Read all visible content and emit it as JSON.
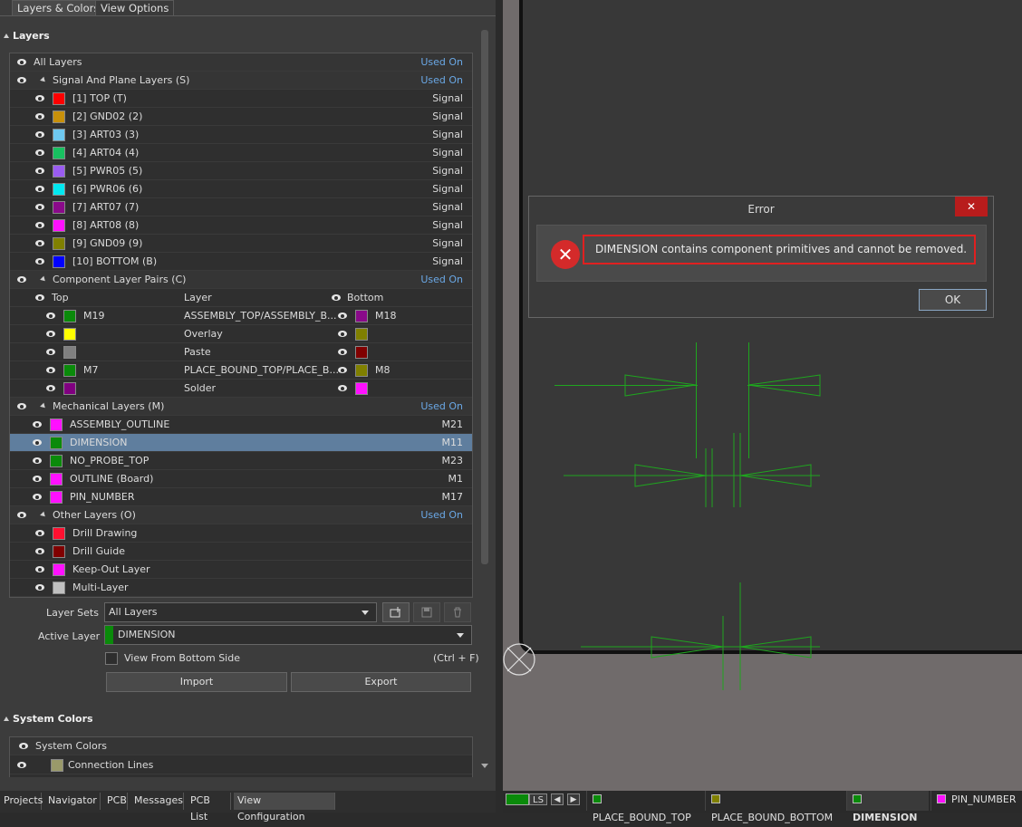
{
  "tabs": {
    "t1": "Layers & Colors",
    "t2": "View Options"
  },
  "layers_title": "Layers",
  "all_layers": {
    "label": "All Layers",
    "used": "Used On"
  },
  "signal": {
    "title": "Signal And Plane Layers (S)",
    "used": "Used On",
    "items": [
      {
        "name": "[1] TOP (T)",
        "type": "Signal",
        "color": "#ff0000"
      },
      {
        "name": "[2] GND02 (2)",
        "type": "Signal",
        "color": "#c8900a"
      },
      {
        "name": "[3] ART03 (3)",
        "type": "Signal",
        "color": "#6ec8f0"
      },
      {
        "name": "[4] ART04 (4)",
        "type": "Signal",
        "color": "#18c060"
      },
      {
        "name": "[5] PWR05 (5)",
        "type": "Signal",
        "color": "#9a5cf0"
      },
      {
        "name": "[6] PWR06 (6)",
        "type": "Signal",
        "color": "#00e8f0"
      },
      {
        "name": "[7] ART07 (7)",
        "type": "Signal",
        "color": "#8a0a8a"
      },
      {
        "name": "[8] ART08 (8)",
        "type": "Signal",
        "color": "#ff10ff"
      },
      {
        "name": "[9] GND09 (9)",
        "type": "Signal",
        "color": "#808000"
      },
      {
        "name": "[10] BOTTOM (B)",
        "type": "Signal",
        "color": "#0000ff"
      }
    ]
  },
  "pairs": {
    "title": "Component Layer Pairs (C)",
    "used": "Used On",
    "h_top": "Top",
    "h_layer": "Layer",
    "h_bottom": "Bottom",
    "items": [
      {
        "top": "M19",
        "layer": "ASSEMBLY_TOP/ASSEMBLY_B...",
        "bottom": "M18",
        "tc": "#0a8a0a",
        "bc": "#8a0a8a"
      },
      {
        "top": "",
        "layer": "Overlay",
        "bottom": "",
        "tc": "#ffff00",
        "bc": "#808000"
      },
      {
        "top": "",
        "layer": "Paste",
        "bottom": "",
        "tc": "#808080",
        "bc": "#800000"
      },
      {
        "top": "M7",
        "layer": "PLACE_BOUND_TOP/PLACE_B...",
        "bottom": "M8",
        "tc": "#0a8a0a",
        "bc": "#808000"
      },
      {
        "top": "",
        "layer": "Solder",
        "bottom": "",
        "tc": "#800080",
        "bc": "#ff10ff"
      }
    ]
  },
  "mech": {
    "title": "Mechanical Layers (M)",
    "used": "Used On",
    "items": [
      {
        "name": "ASSEMBLY_OUTLINE",
        "m": "M21",
        "color": "#ff10ff"
      },
      {
        "name": "DIMENSION",
        "m": "M11",
        "color": "#0a8a0a"
      },
      {
        "name": "NO_PROBE_TOP",
        "m": "M23",
        "color": "#0a8a0a"
      },
      {
        "name": "OUTLINE (Board)",
        "m": "M1",
        "color": "#ff10ff"
      },
      {
        "name": "PIN_NUMBER",
        "m": "M17",
        "color": "#ff10ff"
      }
    ]
  },
  "other": {
    "title": "Other Layers (O)",
    "used": "Used On",
    "items": [
      {
        "name": "Drill Drawing",
        "color": "#ff1030"
      },
      {
        "name": "Drill Guide",
        "color": "#800000"
      },
      {
        "name": "Keep-Out Layer",
        "color": "#ff10ff"
      },
      {
        "name": "Multi-Layer",
        "color": "#c0c0c0"
      }
    ]
  },
  "controls": {
    "layer_sets_label": "Layer Sets",
    "layer_sets_value": "All Layers",
    "active_layer_label": "Active Layer",
    "active_layer_value": "DIMENSION",
    "active_color": "#0a8a0a",
    "view_bottom": "View From Bottom Side",
    "shortcut": "(Ctrl + F)",
    "import": "Import",
    "export": "Export"
  },
  "system": {
    "title": "System Colors",
    "hdr": "System Colors",
    "item": "Connection Lines",
    "item_color": "#9a9a6a"
  },
  "bottom_tabs": [
    "Projects",
    "Navigator",
    "PCB",
    "Messages",
    "PCB List",
    "View Configuration"
  ],
  "dialog": {
    "title": "Error",
    "close": "✕",
    "message": "DIMENSION contains component primitives and cannot be removed.",
    "ok": "OK"
  },
  "status": {
    "ls": "LS",
    "layers": [
      {
        "name": "PLACE_BOUND_TOP",
        "color": "#0a8a0a"
      },
      {
        "name": "PLACE_BOUND_BOTTOM",
        "color": "#808000"
      },
      {
        "name": "DIMENSION",
        "color": "#0a8a0a"
      },
      {
        "name": "PIN_NUMBER",
        "color": "#ff10ff"
      }
    ]
  }
}
